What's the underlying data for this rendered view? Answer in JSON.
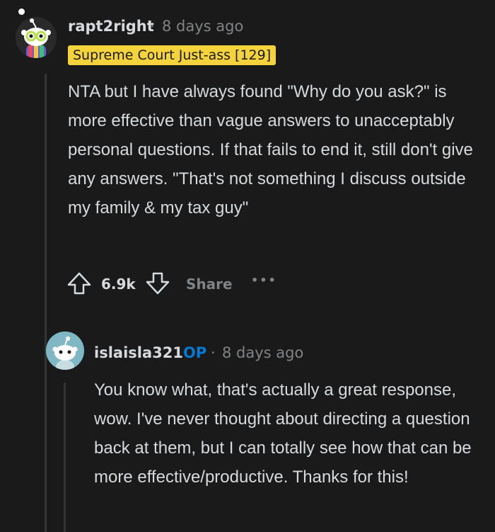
{
  "comment": {
    "username": "rapt2right",
    "separator": "·",
    "time": "8 days ago",
    "flair": "Supreme Court Just-ass [129]",
    "body": "NTA but I have always found \"Why do you ask?\" is more effective than vague answers to unacceptably personal questions. If that fails to end it, still don't give any answers. \"That's not something I discuss outside my family & my tax guy\"",
    "score": "6.9k",
    "share_label": "Share",
    "more_label": "•••"
  },
  "reply": {
    "username": "islaisla321",
    "op_label": "OP",
    "separator": "·",
    "time": "8 days ago",
    "body": "You know what, that's actually a great response, wow. I've never thought about directing a question back at them, but I can totally see how that can be more effective/productive. Thanks for this!"
  },
  "colors": {
    "background": "#1a1a1b",
    "flair_bg": "#f5d33d",
    "op_blue": "#0079d3",
    "muted": "#818384"
  }
}
